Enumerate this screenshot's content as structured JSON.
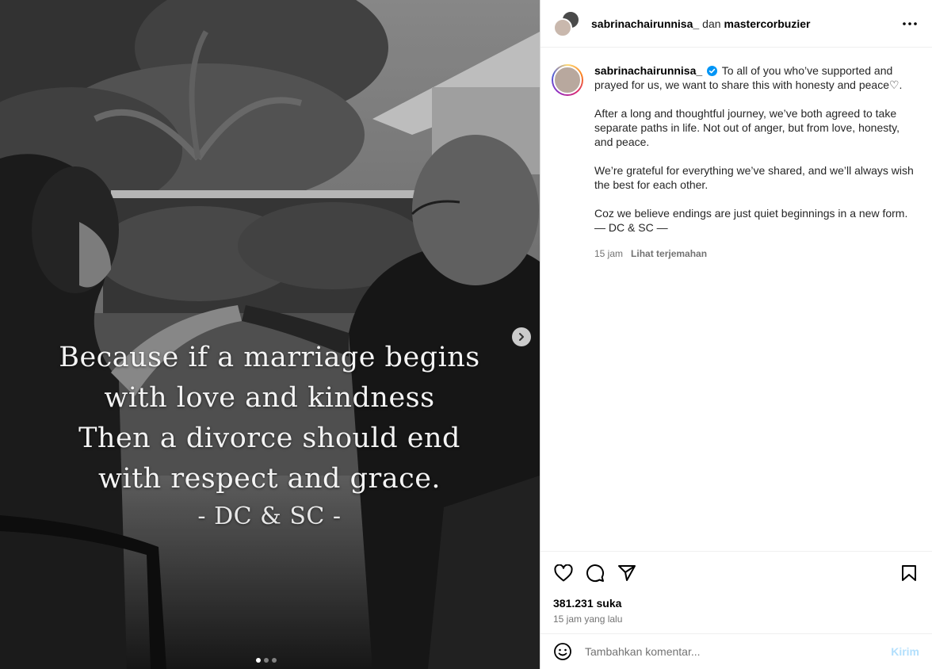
{
  "media": {
    "quote_lines": [
      "Because if a marriage begins",
      "with love and kindness",
      "Then a divorce should end",
      "with respect and grace."
    ],
    "quote_signature": "- DC & SC -",
    "carousel": {
      "count": 3,
      "active": 1
    },
    "icons": {
      "next": "chevron-right-icon"
    }
  },
  "header": {
    "user1": "sabrinachairunnisa_",
    "connector": "dan",
    "user2": "mastercorbuzier",
    "more_icon": "more-horizontal-icon"
  },
  "caption": {
    "username": "sabrinachairunnisa_",
    "verified": true,
    "first": "To all of you who’ve supported and prayed for us, we want to share this with honesty and peace♡.",
    "p2": "After a long and thoughtful journey, we’ve both agreed to take separate paths in life. Not out of anger, but from love, honesty, and peace.",
    "p3": "We’re grateful for everything we’ve shared, and we’ll always wish the best for each other.",
    "p4a": "Coz we believe endings are just quiet beginnings in a new form.",
    "p4b": "— DC & SC —",
    "age": "15 jam",
    "translate": "Lihat terjemahan"
  },
  "actions": {
    "icons": [
      "heart-icon",
      "comment-icon",
      "share-icon",
      "bookmark-icon"
    ],
    "likes": "381.231 suka",
    "time": "15 jam yang lalu"
  },
  "comment": {
    "placeholder": "Tambahkan komentar...",
    "send": "Kirim",
    "emoji_icon": "emoji-icon"
  },
  "colors": {
    "verified": "#0095f6",
    "send_disabled": "#b2dffc",
    "secondary_text": "#737373"
  }
}
